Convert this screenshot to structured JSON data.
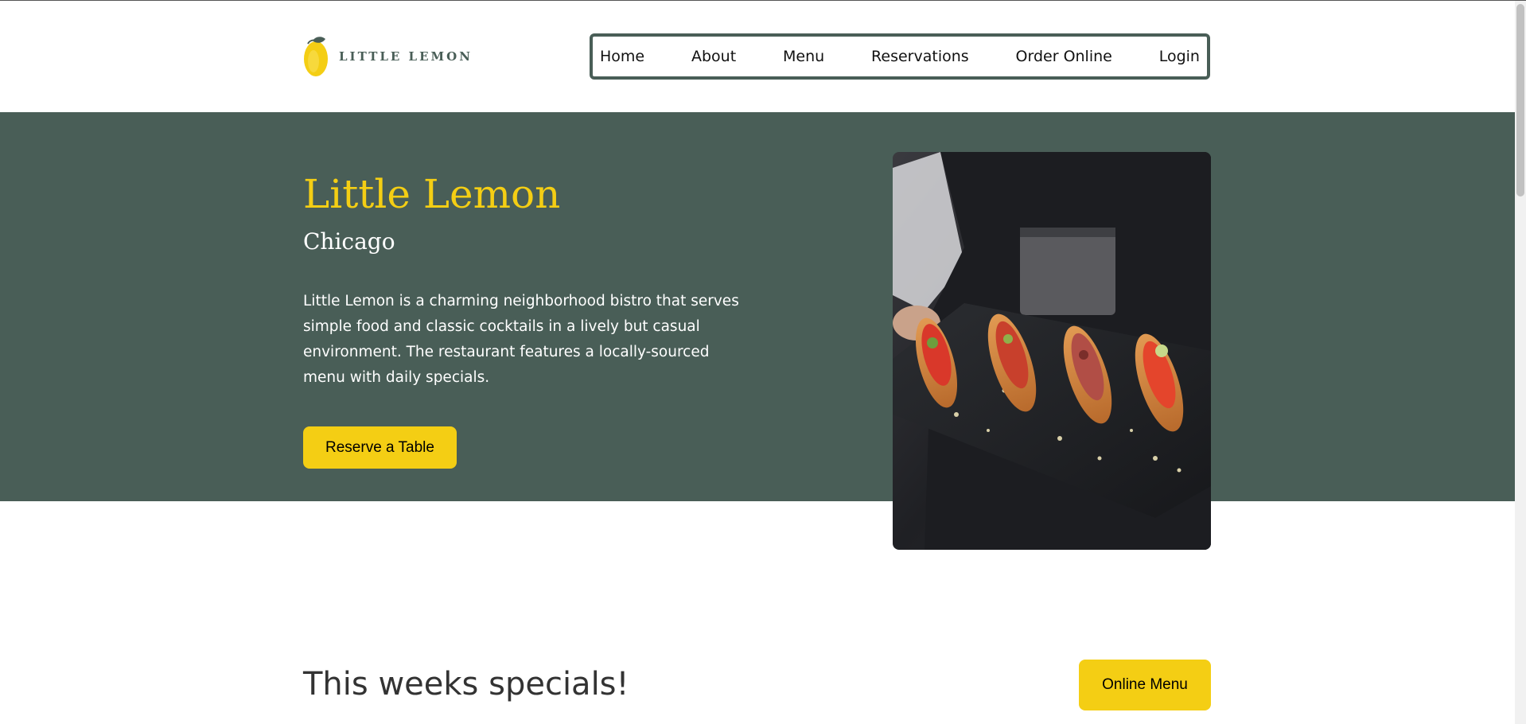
{
  "brand": {
    "logo_text": "LITTLE LEMON",
    "primary_color": "#495e57",
    "accent_color": "#f4ce14"
  },
  "nav": {
    "items": [
      {
        "label": "Home"
      },
      {
        "label": "About"
      },
      {
        "label": "Menu"
      },
      {
        "label": "Reservations"
      },
      {
        "label": "Order Online"
      },
      {
        "label": "Login"
      }
    ]
  },
  "hero": {
    "title": "Little Lemon",
    "subtitle": "Chicago",
    "description": "Little Lemon is a charming neighborhood bistro that serves simple food and classic cocktails in a lively but casual environment. The restaurant features a locally-sourced menu with daily specials.",
    "cta_label": "Reserve a Table",
    "image_icon": "food-photo"
  },
  "specials": {
    "title": "This weeks specials!",
    "button_label": "Online Menu"
  }
}
